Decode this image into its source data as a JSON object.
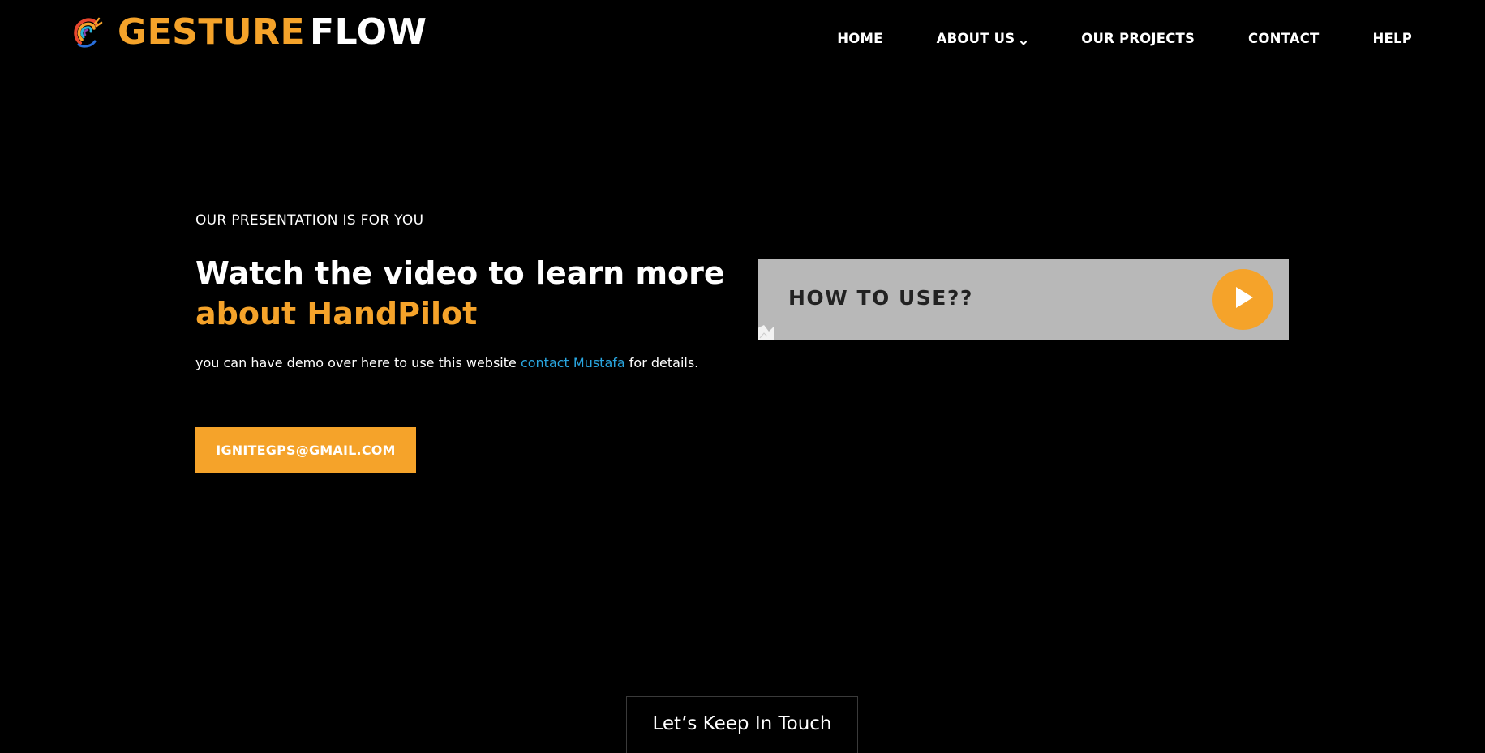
{
  "brand": {
    "word1": "GESTURE",
    "word2": "FLOW",
    "logo_icon": "colorful-hand-swirl-icon"
  },
  "nav": {
    "items": [
      {
        "label": "HOME"
      },
      {
        "label": "ABOUT US",
        "has_dropdown": true
      },
      {
        "label": "OUR PROJECTS"
      },
      {
        "label": "CONTACT"
      },
      {
        "label": "HELP"
      }
    ]
  },
  "hero": {
    "eyebrow": "OUR PRESENTATION IS FOR YOU",
    "headline_line1": "Watch the video to learn more",
    "headline_line2": "about HandPilot",
    "desc_before": "you can have demo over here to use this website ",
    "desc_link": "contact Mustafa",
    "desc_after": " for details.",
    "email_button": "IGNITEGPS@GMAIL.COM"
  },
  "video": {
    "title": "HOW TO USE??",
    "play_icon": "play-icon"
  },
  "footer": {
    "keep_in_touch": "Let’s Keep In Touch"
  },
  "colors": {
    "background": "#000000",
    "accent": "#f5a32a",
    "link": "#29a6e0",
    "video_card_bg": "#b8b8b8"
  }
}
